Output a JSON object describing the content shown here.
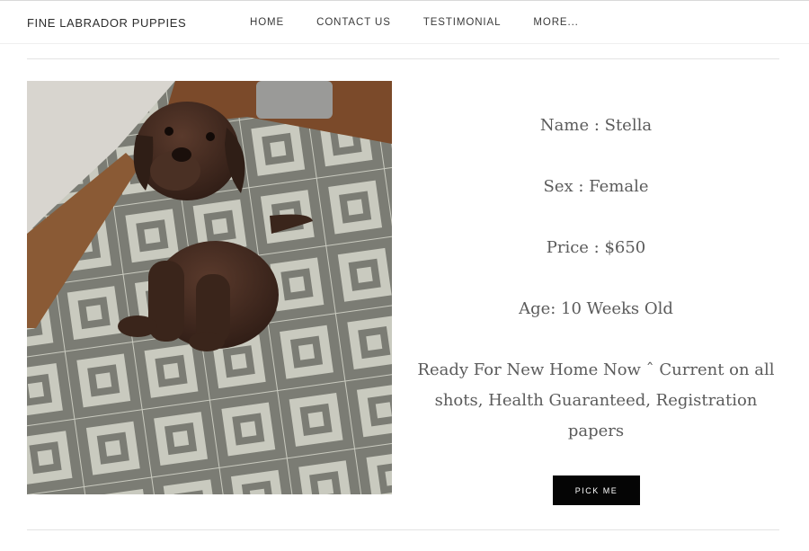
{
  "header": {
    "site_title": "FINE LABRADOR PUPPIES",
    "nav": [
      "HOME",
      "CONTACT US",
      "TESTIMONIAL",
      "MORE..."
    ]
  },
  "listing": {
    "name": "Name : Stella",
    "sex": "Sex : Female",
    "price": "Price : $650",
    "age": "Age: 10 Weeks Old",
    "description": "Ready For New Home Now ˆ Current on all shots, Health Guaranteed, Registration papers",
    "cta": "PICK ME"
  },
  "colors": {
    "button_bg": "#050505",
    "button_text": "#ffffff",
    "text": "#5b5b5b"
  }
}
